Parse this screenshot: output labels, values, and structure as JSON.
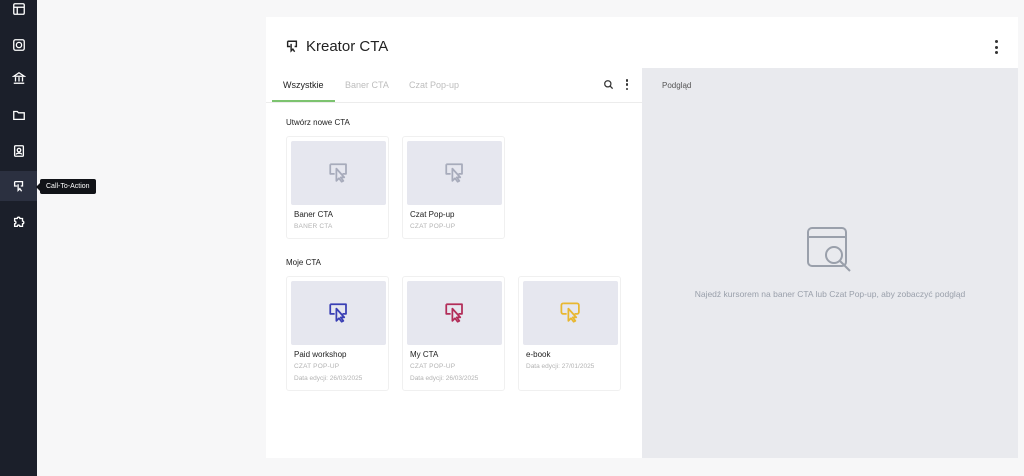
{
  "sidebar": {
    "icons": [
      "layout-icon",
      "target-icon",
      "bank-icon",
      "folder-icon",
      "contact-book-icon",
      "cta-icon",
      "puzzle-icon"
    ],
    "tooltip": "Call-To-Action"
  },
  "header": {
    "title": "Kreator CTA"
  },
  "tabs": [
    {
      "label": "Wszystkie"
    },
    {
      "label": "Baner CTA"
    },
    {
      "label": "Czat Pop-up"
    }
  ],
  "create_section": {
    "label": "Utwórz nowe CTA",
    "cards": [
      {
        "name": "Baner CTA",
        "type": "BANER CTA",
        "icon_color": "#a7abbb"
      },
      {
        "name": "Czat Pop-up",
        "type": "CZAT POP-UP",
        "icon_color": "#a7abbb"
      }
    ]
  },
  "my_section": {
    "label": "Moje CTA",
    "cards": [
      {
        "name": "Paid workshop",
        "type": "CZAT POP-UP",
        "date": "Data edycji: 26/03/2025",
        "icon_color": "#3a3fb4"
      },
      {
        "name": "My CTA",
        "type": "CZAT POP-UP",
        "date": "Data edycji: 26/03/2025",
        "icon_color": "#b22c58"
      },
      {
        "name": "e-book",
        "type": "",
        "date": "Data edycji: 27/01/2025",
        "icon_color": "#e8b730"
      }
    ]
  },
  "preview": {
    "label": "Podgląd",
    "message": "Najedź kursorem na baner CTA lub Czat Pop-up, aby zobaczyć podgląd"
  },
  "colors": {
    "accent": "#7cc36f",
    "sidebar_bg": "#1b1f2a",
    "preview_bg": "#e9eaee"
  }
}
